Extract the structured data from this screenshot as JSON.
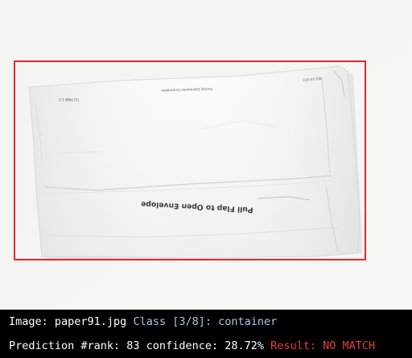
{
  "info_bar": {
    "line1": {
      "image_label": "Image: paper91.jpg",
      "class_label": "Class [3/8]: container"
    },
    "line2": {
      "prediction_label": "Prediction #rank: 83 confidence: 28.72%",
      "result_label": "Result: NO MATCH"
    }
  },
  "photo": {
    "envelope_print_main": "Pull Flap to Open Envelope",
    "envelope_print_small_left": "7217686 1.5",
    "envelope_print_small_center": "Priority Distribution Corporation",
    "envelope_print_small_right": "9LS-14 1D7"
  },
  "colors": {
    "info_bar_bg": "#000000",
    "info_text": "#ffffff",
    "class_text": "#aec6e8",
    "no_match_text": "#e83c3c",
    "bbox_stroke": "#e8242a",
    "background_wall": "#f5f5f3",
    "envelope_paper": "#fafaf8"
  }
}
